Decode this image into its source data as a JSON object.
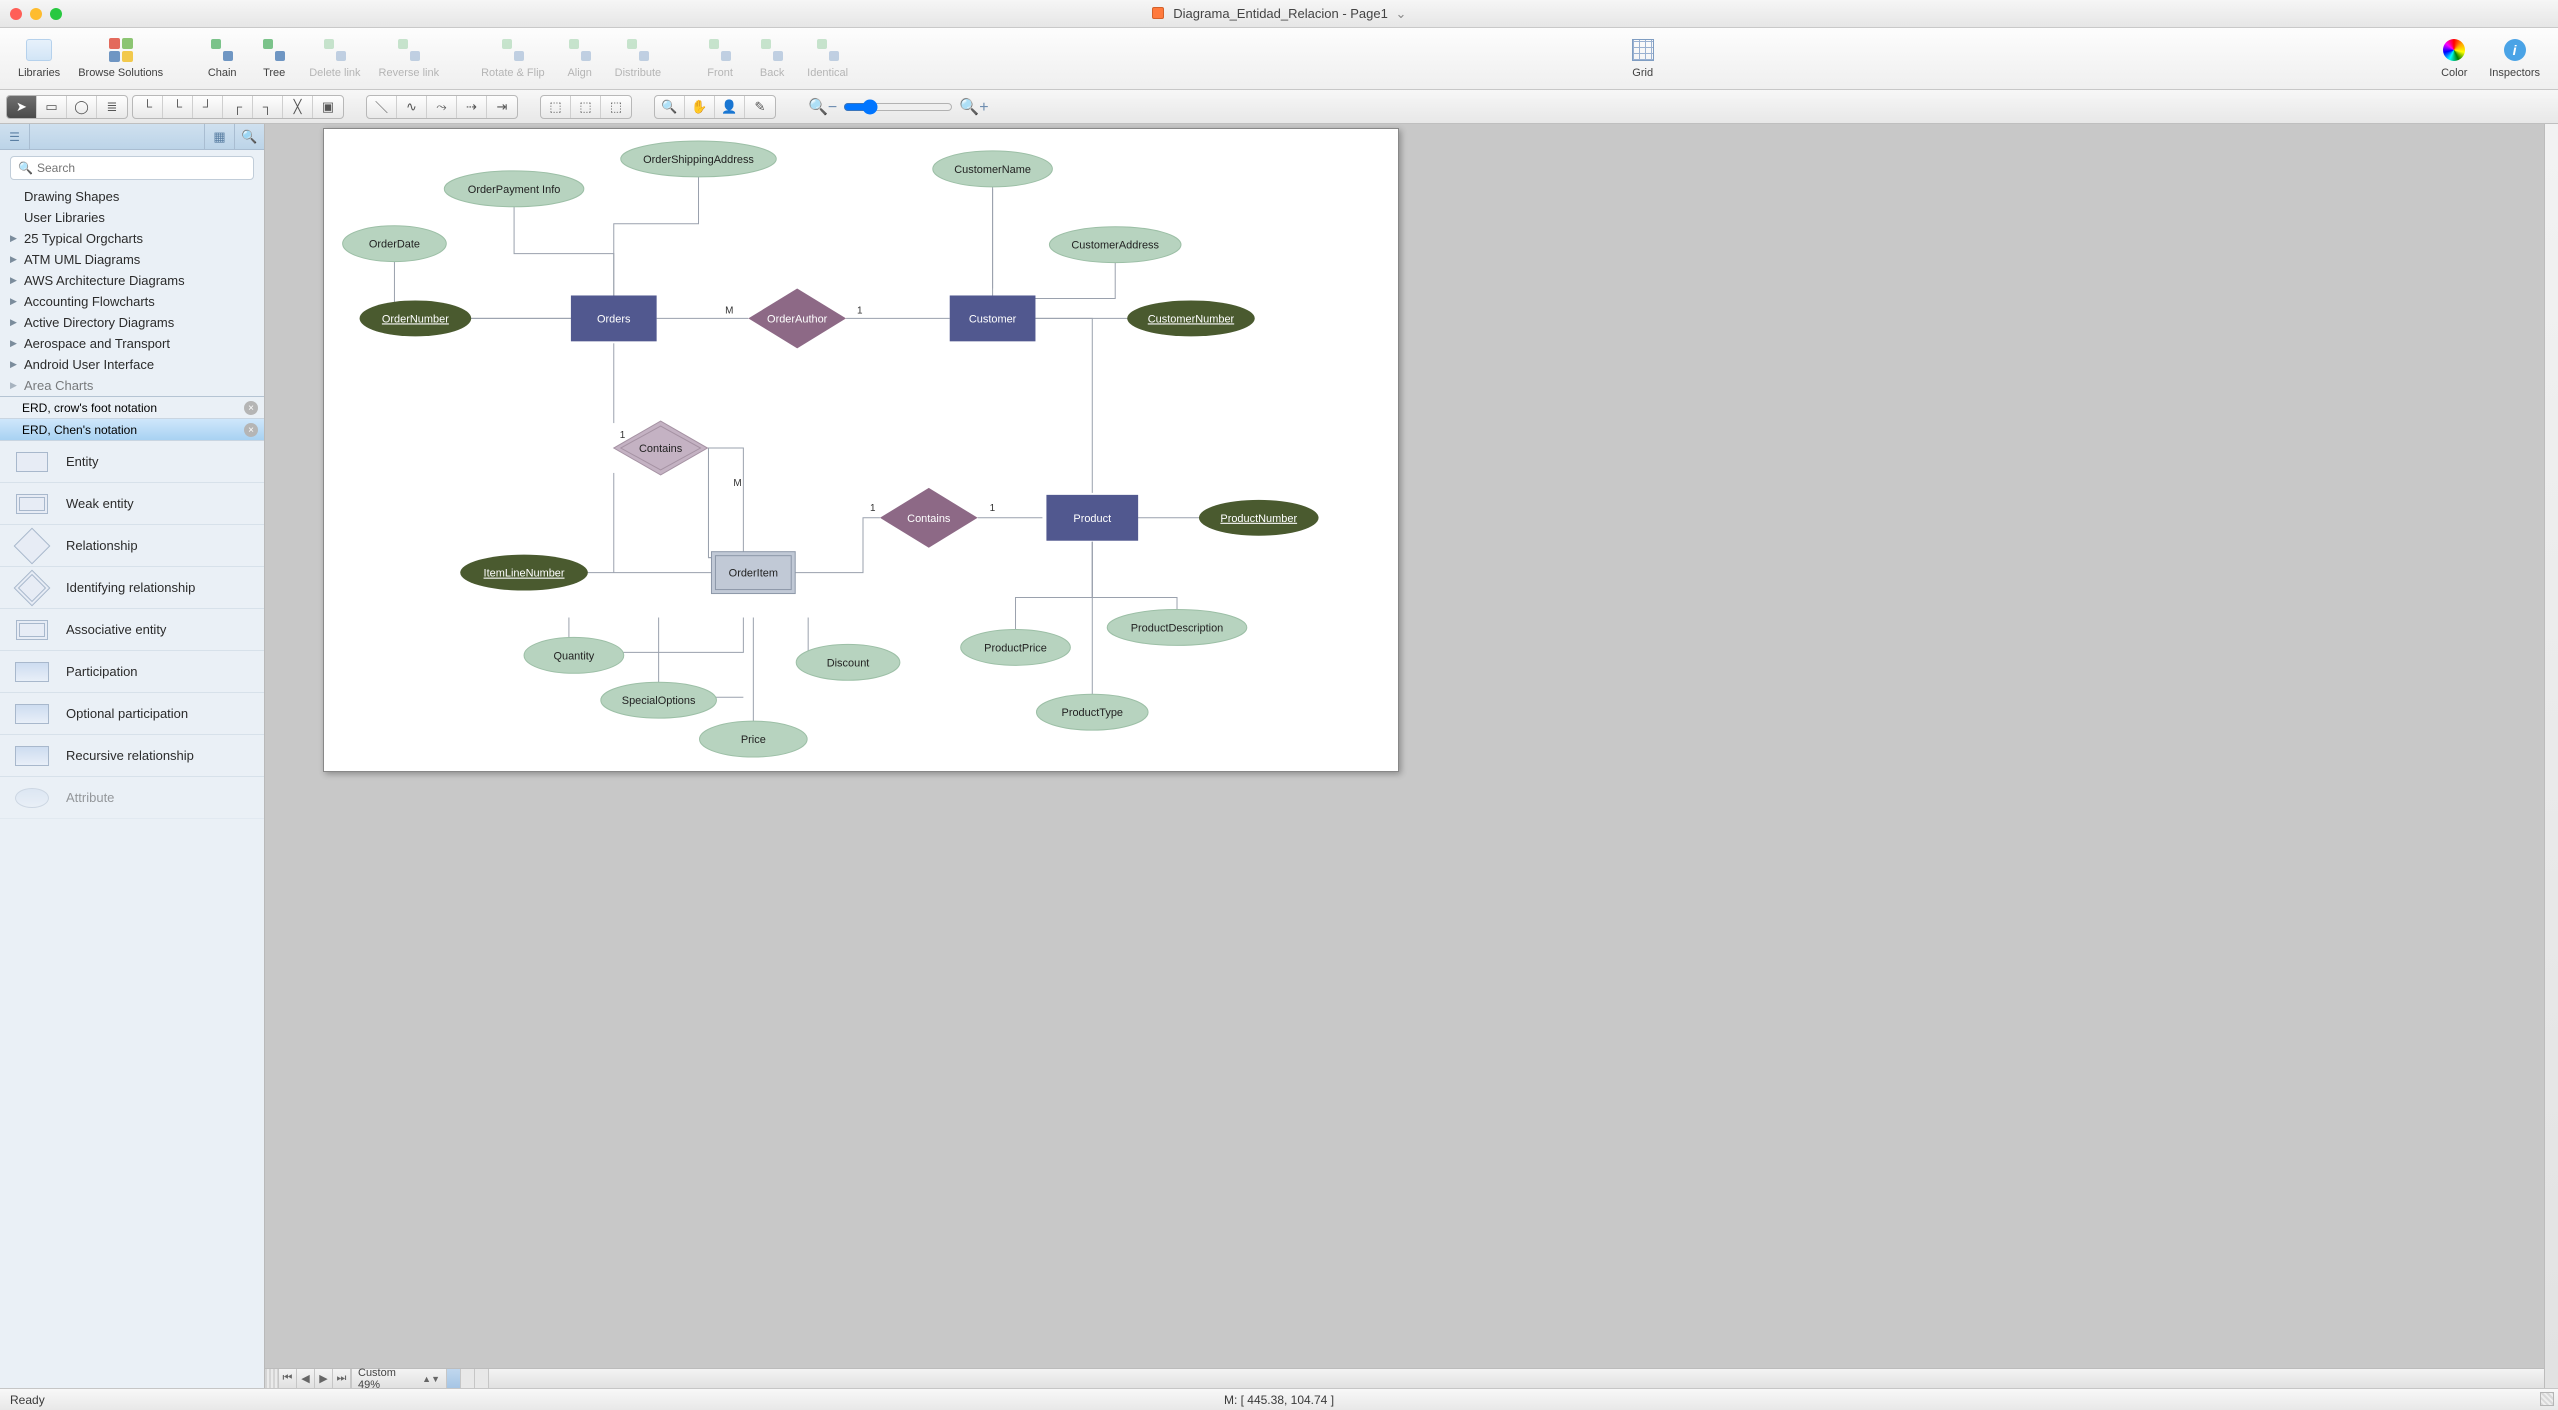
{
  "window": {
    "title": "Diagrama_Entidad_Relacion - Page1"
  },
  "toolbar": {
    "libraries": "Libraries",
    "browse": "Browse Solutions",
    "chain": "Chain",
    "tree": "Tree",
    "delete_link": "Delete link",
    "reverse_link": "Reverse link",
    "rotate_flip": "Rotate & Flip",
    "align": "Align",
    "distribute": "Distribute",
    "front": "Front",
    "back": "Back",
    "identical": "Identical",
    "grid": "Grid",
    "color": "Color",
    "inspectors": "Inspectors"
  },
  "sidebar": {
    "search_placeholder": "Search",
    "tree": [
      "Drawing Shapes",
      "User Libraries",
      "25 Typical Orgcharts",
      "ATM UML Diagrams",
      "AWS Architecture Diagrams",
      "Accounting Flowcharts",
      "Active Directory Diagrams",
      "Aerospace and Transport",
      "Android User Interface",
      "Area Charts"
    ],
    "lib_tabs": [
      {
        "label": "ERD, crow's foot notation",
        "selected": false
      },
      {
        "label": "ERD, Chen's notation",
        "selected": true
      }
    ],
    "shapes": [
      "Entity",
      "Weak entity",
      "Relationship",
      "Identifying relationship",
      "Associative entity",
      "Participation",
      "Optional participation",
      "Recursive relationship",
      "Attribute"
    ]
  },
  "canvas_footer": {
    "zoom": "Custom 49%"
  },
  "status": {
    "left": "Ready",
    "mid": "M: [ 445.38, 104.74 ]"
  },
  "diagram": {
    "entities": {
      "orders": "Orders",
      "customer": "Customer",
      "product": "Product",
      "orderitem": "OrderItem"
    },
    "relationships": {
      "orderauthor": "OrderAuthor",
      "contains1": "Contains",
      "contains2": "Contains"
    },
    "attributes": {
      "orderdate": "OrderDate",
      "orderpayment": "OrderPayment Info",
      "ordershipping": "OrderShippingAddress",
      "ordernumber": "OrderNumber",
      "customername": "CustomerName",
      "customeraddress": "CustomerAddress",
      "customernumber": "CustomerNumber",
      "itemlinenumber": "ItemLineNumber",
      "quantity": "Quantity",
      "specialoptions": "SpecialOptions",
      "price": "Price",
      "discount": "Discount",
      "productprice": "ProductPrice",
      "productdescription": "ProductDescription",
      "producttype": "ProductType",
      "productnumber": "ProductNumber"
    },
    "cardinalities": {
      "M": "M",
      "one": "1"
    }
  }
}
